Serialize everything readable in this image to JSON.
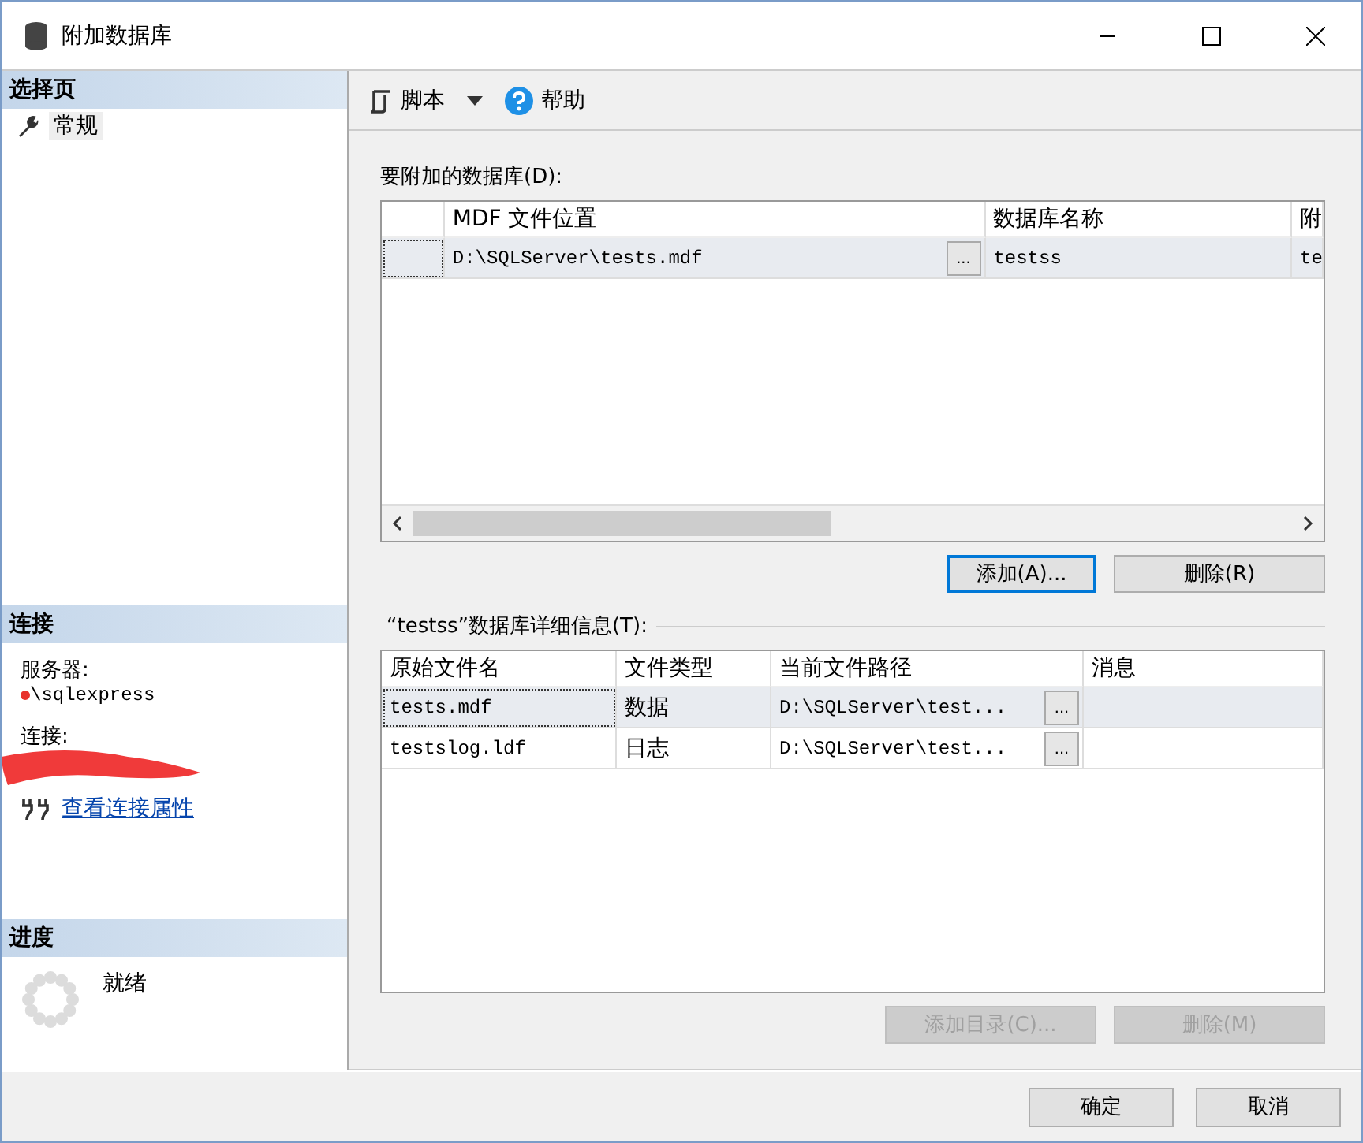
{
  "window": {
    "title": "附加数据库"
  },
  "sidebar": {
    "title": "选择页",
    "items": [
      {
        "label": "常规",
        "selected": true
      }
    ]
  },
  "connection": {
    "title": "连接",
    "server_label": "服务器:",
    "server_value": "\\sqlexpress",
    "connection_label": "连接:",
    "link": "查看连接属性"
  },
  "progress": {
    "title": "进度",
    "status": "就绪"
  },
  "toolbar": {
    "script": "脚本",
    "help": "帮助"
  },
  "databases": {
    "label": "要附加的数据库(D):",
    "columns": [
      "",
      "MDF 文件位置",
      "数据库名称",
      "附"
    ],
    "rows": [
      {
        "selected": true,
        "cells": [
          {
            "text": ""
          },
          {
            "text": "D:\\SQLServer\\tests.mdf",
            "browse": "..."
          },
          {
            "text": "testss"
          },
          {
            "text": "te"
          }
        ]
      }
    ],
    "buttons": [
      {
        "label": "添加(A)...",
        "disabled": false,
        "default": true
      },
      {
        "label": "删除(R)",
        "disabled": false,
        "default": false
      }
    ]
  },
  "details": {
    "label": "“testss”数据库详细信息(T):",
    "columns": [
      "原始文件名",
      "文件类型",
      "当前文件路径",
      "消息"
    ],
    "rows": [
      {
        "selected": true,
        "cells": [
          {
            "text": "tests.mdf"
          },
          {
            "text": "数据"
          },
          {
            "text": "D:\\SQLServer\\test...",
            "browse": "..."
          },
          {
            "text": ""
          }
        ]
      },
      {
        "selected": false,
        "cells": [
          {
            "text": "testslog.ldf"
          },
          {
            "text": "日志"
          },
          {
            "text": "D:\\SQLServer\\test...",
            "browse": "..."
          },
          {
            "text": ""
          }
        ]
      }
    ],
    "buttons": [
      {
        "label": "添加目录(C)...",
        "disabled": true,
        "default": false
      },
      {
        "label": "删除(M)",
        "disabled": true,
        "default": false
      }
    ]
  },
  "footer": {
    "buttons": [
      {
        "label": "确定",
        "disabled": false,
        "default": false
      },
      {
        "label": "取消",
        "disabled": false,
        "default": false
      }
    ]
  }
}
